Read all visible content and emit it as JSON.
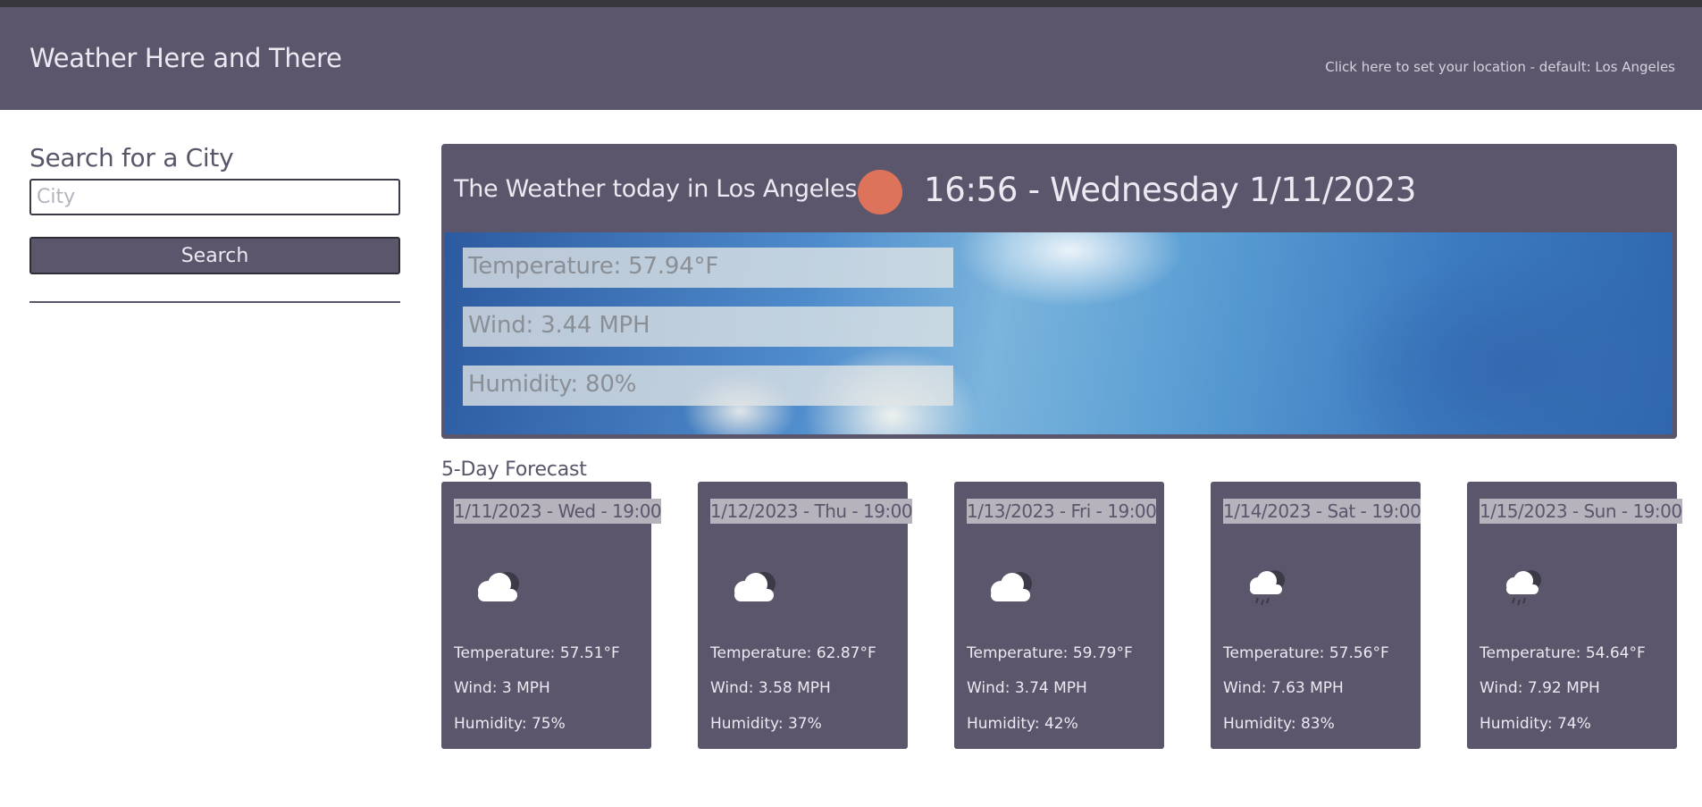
{
  "header": {
    "title": "Weather Here and There",
    "location_link": "Click here to set your location - default: Los Angeles"
  },
  "sidebar": {
    "heading": "Search for a City",
    "search_placeholder": "City",
    "search_value": "",
    "search_button": "Search"
  },
  "current": {
    "title": "The Weather today in Los Angeles",
    "icon": "sun-icon",
    "datetime": "16:56 - Wednesday 1/11/2023",
    "temperature": "Temperature: 57.94°F",
    "wind": "Wind: 3.44 MPH",
    "humidity": "Humidity: 80%"
  },
  "forecast": {
    "title": "5-Day Forecast",
    "days": [
      {
        "date": "1/11/2023 - Wed - 19:00",
        "icon": "cloud-icon",
        "temperature": "Temperature: 57.51°F",
        "wind": "Wind: 3 MPH",
        "humidity": "Humidity: 75%"
      },
      {
        "date": "1/12/2023 - Thu - 19:00",
        "icon": "cloud-icon",
        "temperature": "Temperature: 62.87°F",
        "wind": "Wind: 3.58 MPH",
        "humidity": "Humidity: 37%"
      },
      {
        "date": "1/13/2023 - Fri - 19:00",
        "icon": "cloud-icon",
        "temperature": "Temperature: 59.79°F",
        "wind": "Wind: 3.74 MPH",
        "humidity": "Humidity: 42%"
      },
      {
        "date": "1/14/2023 - Sat - 19:00",
        "icon": "rain-cloud-icon",
        "temperature": "Temperature: 57.56°F",
        "wind": "Wind: 7.63 MPH",
        "humidity": "Humidity: 83%"
      },
      {
        "date": "1/15/2023 - Sun - 19:00",
        "icon": "rain-cloud-icon",
        "temperature": "Temperature: 54.64°F",
        "wind": "Wind: 7.92 MPH",
        "humidity": "Humidity: 74%"
      }
    ]
  },
  "colors": {
    "header_bg": "#5b566b",
    "card_bg": "#5b566b",
    "sun": "#de735c"
  }
}
